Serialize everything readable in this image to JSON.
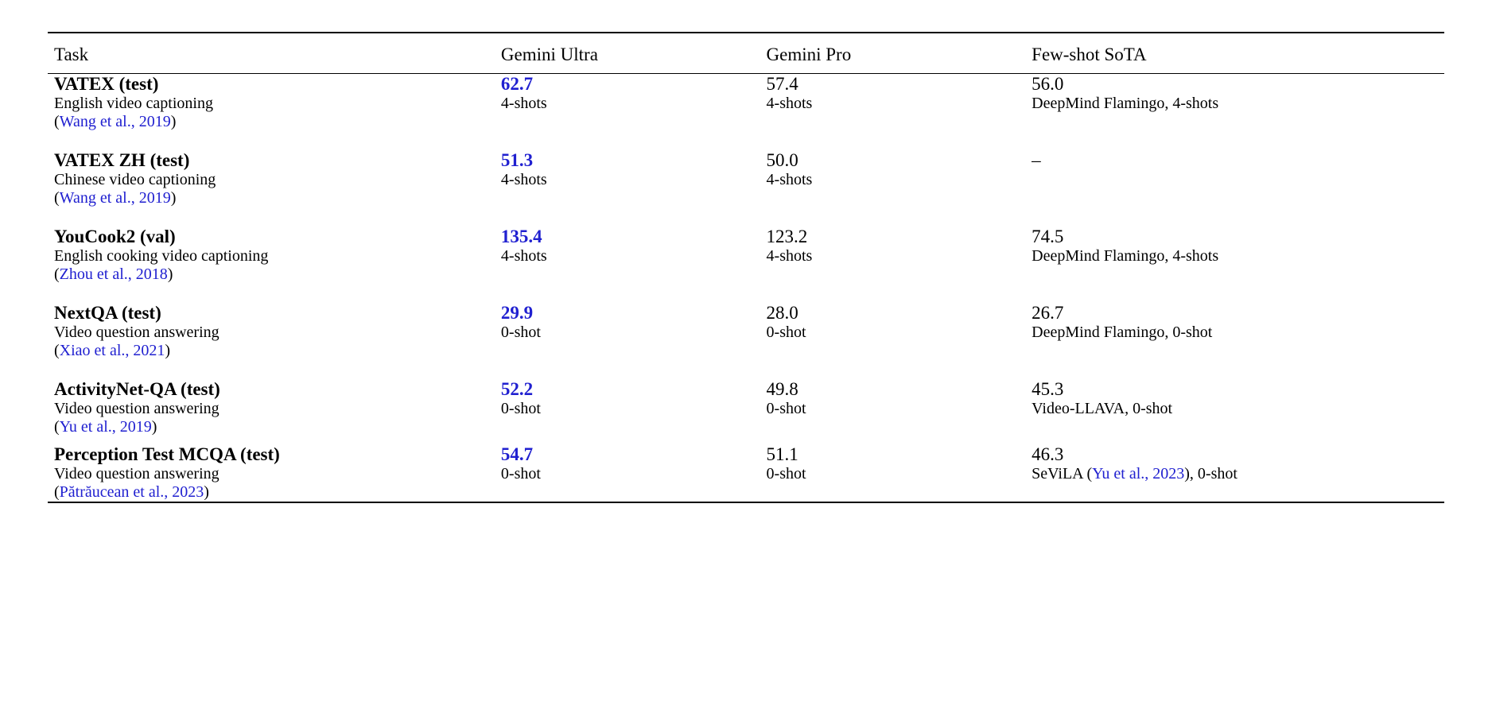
{
  "chart_data": {
    "type": "table",
    "columns": [
      "Task",
      "Gemini Ultra",
      "Gemini Pro",
      "Few-shot SoTA"
    ],
    "rows": [
      {
        "task": "VATEX (test)",
        "ultra": "62.7",
        "pro": "57.4",
        "sota": "56.0"
      },
      {
        "task": "VATEX ZH (test)",
        "ultra": "51.3",
        "pro": "50.0",
        "sota": "–"
      },
      {
        "task": "YouCook2 (val)",
        "ultra": "135.4",
        "pro": "123.2",
        "sota": "74.5"
      },
      {
        "task": "NextQA (test)",
        "ultra": "29.9",
        "pro": "28.0",
        "sota": "26.7"
      },
      {
        "task": "ActivityNet-QA (test)",
        "ultra": "52.2",
        "pro": "49.8",
        "sota": "45.3"
      },
      {
        "task": "Perception Test MCQA (test)",
        "ultra": "54.7",
        "pro": "51.1",
        "sota": "46.3"
      }
    ]
  },
  "headers": {
    "task": "Task",
    "ultra": "Gemini Ultra",
    "pro": "Gemini Pro",
    "sota": "Few-shot SoTA"
  },
  "rows": [
    {
      "task_name": "VATEX (test)",
      "task_desc": "English video captioning",
      "task_cite": "Wang et al., 2019",
      "ultra_val": "62.7",
      "ultra_sub": "4-shots",
      "pro_val": "57.4",
      "pro_sub": "4-shots",
      "sota_val": "56.0",
      "sota_sub_prefix": "DeepMind Flamingo, 4-shots",
      "sota_sub_cite": "",
      "sota_sub_suffix": "",
      "spacer_after": true
    },
    {
      "task_name": "VATEX ZH (test)",
      "task_desc": "Chinese video captioning",
      "task_cite": "Wang et al., 2019",
      "ultra_val": "51.3",
      "ultra_sub": "4-shots",
      "pro_val": "50.0",
      "pro_sub": "4-shots",
      "sota_val": "–",
      "sota_sub_prefix": "",
      "sota_sub_cite": "",
      "sota_sub_suffix": "",
      "spacer_after": true
    },
    {
      "task_name": "YouCook2 (val)",
      "task_desc": "English cooking video captioning",
      "task_cite": "Zhou et al., 2018",
      "ultra_val": "135.4",
      "ultra_sub": "4-shots",
      "pro_val": "123.2",
      "pro_sub": "4-shots",
      "sota_val": "74.5",
      "sota_sub_prefix": "DeepMind Flamingo, 4-shots",
      "sota_sub_cite": "",
      "sota_sub_suffix": "",
      "spacer_after": true
    },
    {
      "task_name": "NextQA (test)",
      "task_desc": "Video question answering",
      "task_cite": "Xiao et al., 2021",
      "ultra_val": "29.9",
      "ultra_sub": "0-shot",
      "pro_val": "28.0",
      "pro_sub": "0-shot",
      "sota_val": "26.7",
      "sota_sub_prefix": "DeepMind Flamingo, 0-shot",
      "sota_sub_cite": "",
      "sota_sub_suffix": "",
      "spacer_after": true
    },
    {
      "task_name": "ActivityNet-QA (test)",
      "task_desc": "Video question answering",
      "task_cite": "Yu et al., 2019",
      "ultra_val": "52.2",
      "ultra_sub": "0-shot",
      "pro_val": "49.8",
      "pro_sub": "0-shot",
      "sota_val": "45.3",
      "sota_sub_prefix": "Video-LLAVA, 0-shot",
      "sota_sub_cite": "",
      "sota_sub_suffix": "",
      "spacer_after": false
    },
    {
      "task_name": "Perception Test MCQA (test)",
      "task_desc": "Video question answering",
      "task_cite": "Pătrăucean et al., 2023",
      "ultra_val": "54.7",
      "ultra_sub": "0-shot",
      "pro_val": "51.1",
      "pro_sub": "0-shot",
      "sota_val": "46.3",
      "sota_sub_prefix": "SeViLA (",
      "sota_sub_cite": "Yu et al., 2023",
      "sota_sub_suffix": "), 0-shot",
      "spacer_after": false
    }
  ]
}
